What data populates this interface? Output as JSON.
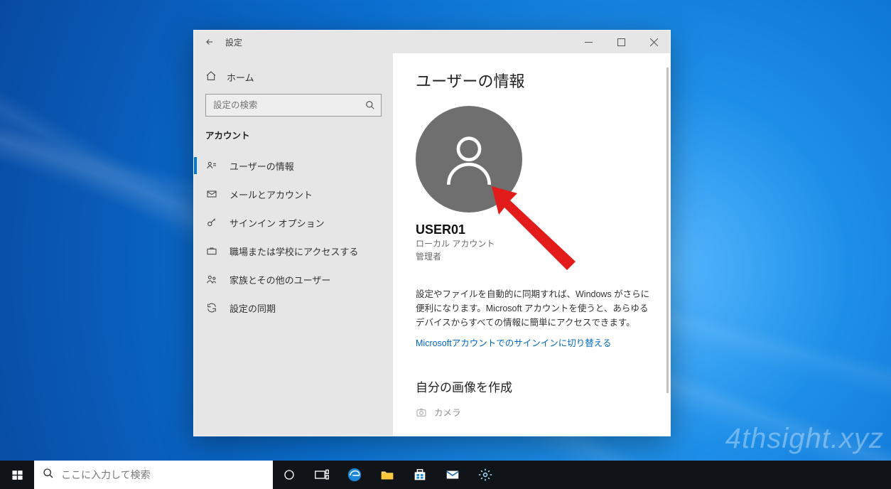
{
  "window": {
    "title": "設定",
    "home": "ホーム",
    "search_placeholder": "設定の検索",
    "section": "アカウント",
    "nav": [
      {
        "icon": "user-card",
        "label": "ユーザーの情報",
        "active": true
      },
      {
        "icon": "mail",
        "label": "メールとアカウント"
      },
      {
        "icon": "key",
        "label": "サインイン オプション"
      },
      {
        "icon": "briefcase",
        "label": "職場または学校にアクセスする"
      },
      {
        "icon": "family",
        "label": "家族とその他のユーザー"
      },
      {
        "icon": "sync",
        "label": "設定の同期"
      }
    ]
  },
  "content": {
    "heading": "ユーザーの情報",
    "username": "USER01",
    "account_type": "ローカル アカウント",
    "role": "管理者",
    "sync_desc": "設定やファイルを自動的に同期すれば、Windows がさらに便利になります。Microsoft アカウントを使うと、あらゆるデバイスからすべての情報に簡単にアクセスできます。",
    "link": "Microsoftアカウントでのサインインに切り替える",
    "create_heading": "自分の画像を作成",
    "camera": "カメラ"
  },
  "taskbar": {
    "search_placeholder": "ここに入力して検索"
  },
  "watermark": "4thsight.xyz"
}
